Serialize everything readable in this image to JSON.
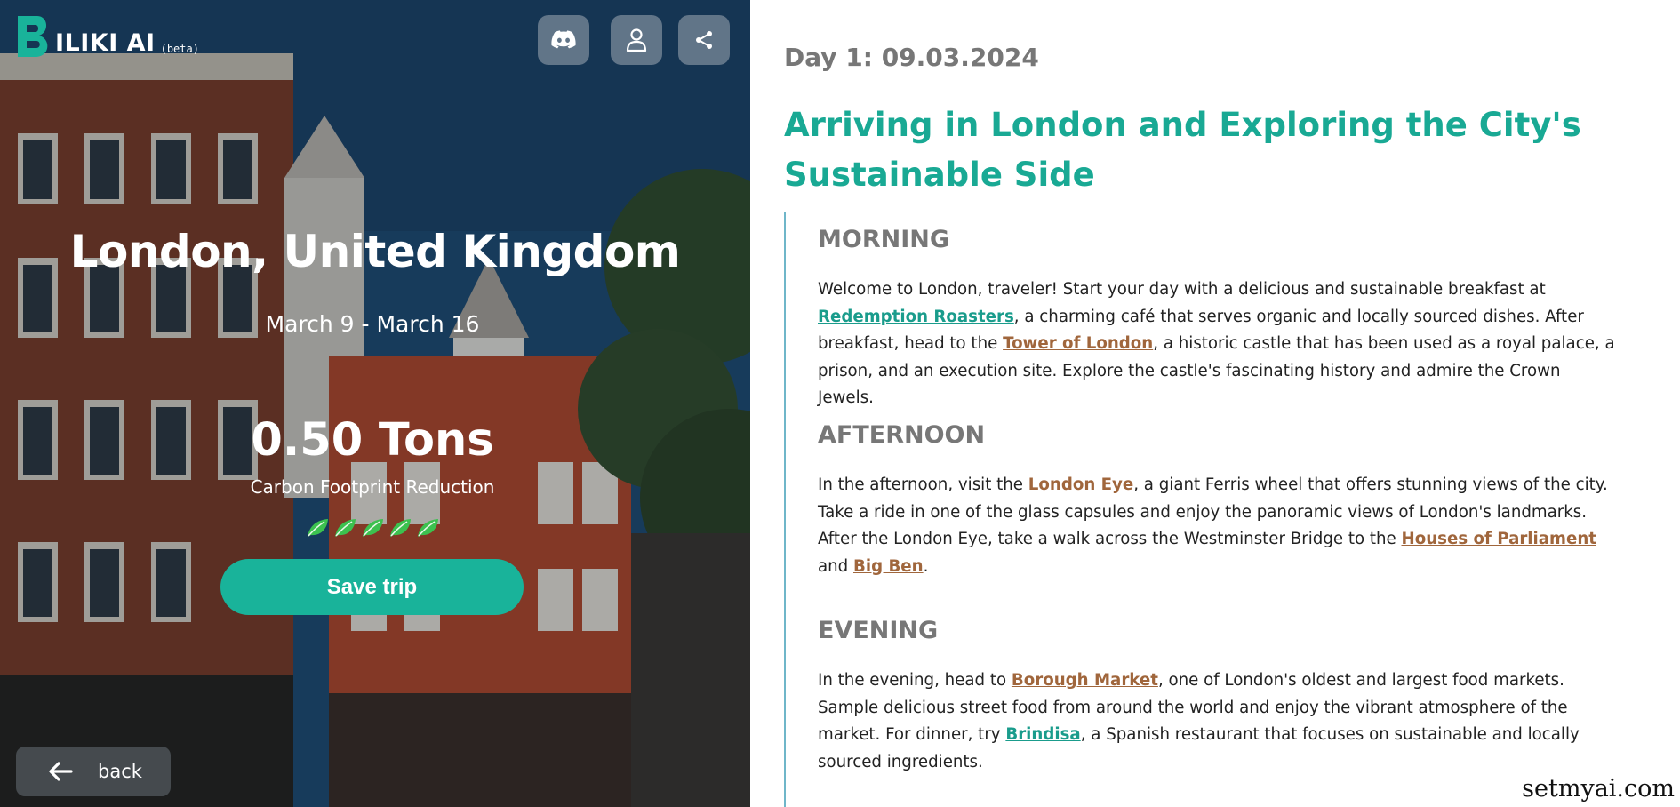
{
  "app": {
    "logo_text": "ILIKI AI",
    "beta_label": "(beta)",
    "accent_color": "#19b39a",
    "link_brown_color": "#a0663c"
  },
  "header_icons": [
    {
      "name": "discord-icon"
    },
    {
      "name": "user-icon"
    },
    {
      "name": "share-icon"
    }
  ],
  "hero": {
    "destination": "London, United Kingdom",
    "dates": "March 9 - March 16",
    "carbon_value": "0.50 Tons",
    "carbon_label": "Carbon Footprint Reduction",
    "leaf_rating": 5,
    "save_label": "Save trip",
    "back_label": "back"
  },
  "itinerary": {
    "day_label": "Day 1: 09.03.2024",
    "day_title": "Arriving in London and Exploring the City's Sustainable Side",
    "morning": {
      "heading": "MORNING",
      "t1": "Welcome to London, traveler! Start your day with a delicious and sustainable breakfast at ",
      "l1": "Redemption Roasters",
      "t2": ", a charming café that serves organic and locally sourced dishes. After breakfast, head to the ",
      "l2": "Tower of London",
      "t3": ", a historic castle that has been used as a royal palace, a prison, and an execution site. Explore the castle's fascinating history and admire the Crown Jewels."
    },
    "afternoon": {
      "heading": "AFTERNOON",
      "t1": "In the afternoon, visit the ",
      "l1": "London Eye",
      "t2": ", a giant Ferris wheel that offers stunning views of the city. Take a ride in one of the glass capsules and enjoy the panoramic views of London's landmarks. After the London Eye, take a walk across the Westminster Bridge to the ",
      "l2": "Houses of Parliament",
      "t3": " and ",
      "l3": "Big Ben",
      "t4": "."
    },
    "evening": {
      "heading": "EVENING",
      "t1": "In the evening, head to ",
      "l1": "Borough Market",
      "t2": ", one of London's oldest and largest food markets. Sample delicious street food from around the world and enjoy the vibrant atmosphere of the market. For dinner, try ",
      "l2": "Brindisa",
      "t3": ", a Spanish restaurant that focuses on sustainable and locally sourced ingredients."
    }
  },
  "watermark": "setmyai.com"
}
